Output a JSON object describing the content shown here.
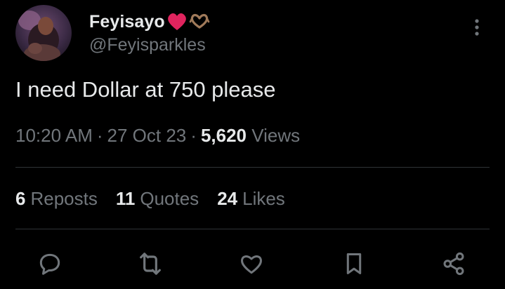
{
  "user": {
    "display_name": "Feyisayo",
    "name_emojis": [
      "red-heart-emoji",
      "heart-hands-emoji"
    ],
    "handle": "@Feyisparkles"
  },
  "tweet": {
    "text": "I need Dollar at 750 please"
  },
  "meta": {
    "time": "10:20 AM",
    "separator": "·",
    "date": "27 Oct 23",
    "views_count": "5,620",
    "views_label": "Views"
  },
  "stats": {
    "reposts_count": "6",
    "reposts_label": "Reposts",
    "quotes_count": "11",
    "quotes_label": "Quotes",
    "likes_count": "24",
    "likes_label": "Likes"
  },
  "actions": [
    "reply-icon",
    "repost-icon",
    "like-icon",
    "bookmark-icon",
    "share-icon"
  ],
  "colors": {
    "background": "#000000",
    "primary_text": "#e7e9ea",
    "secondary_text": "#71767b",
    "divider": "#2f3336",
    "heart_emoji": "#e0245e"
  }
}
